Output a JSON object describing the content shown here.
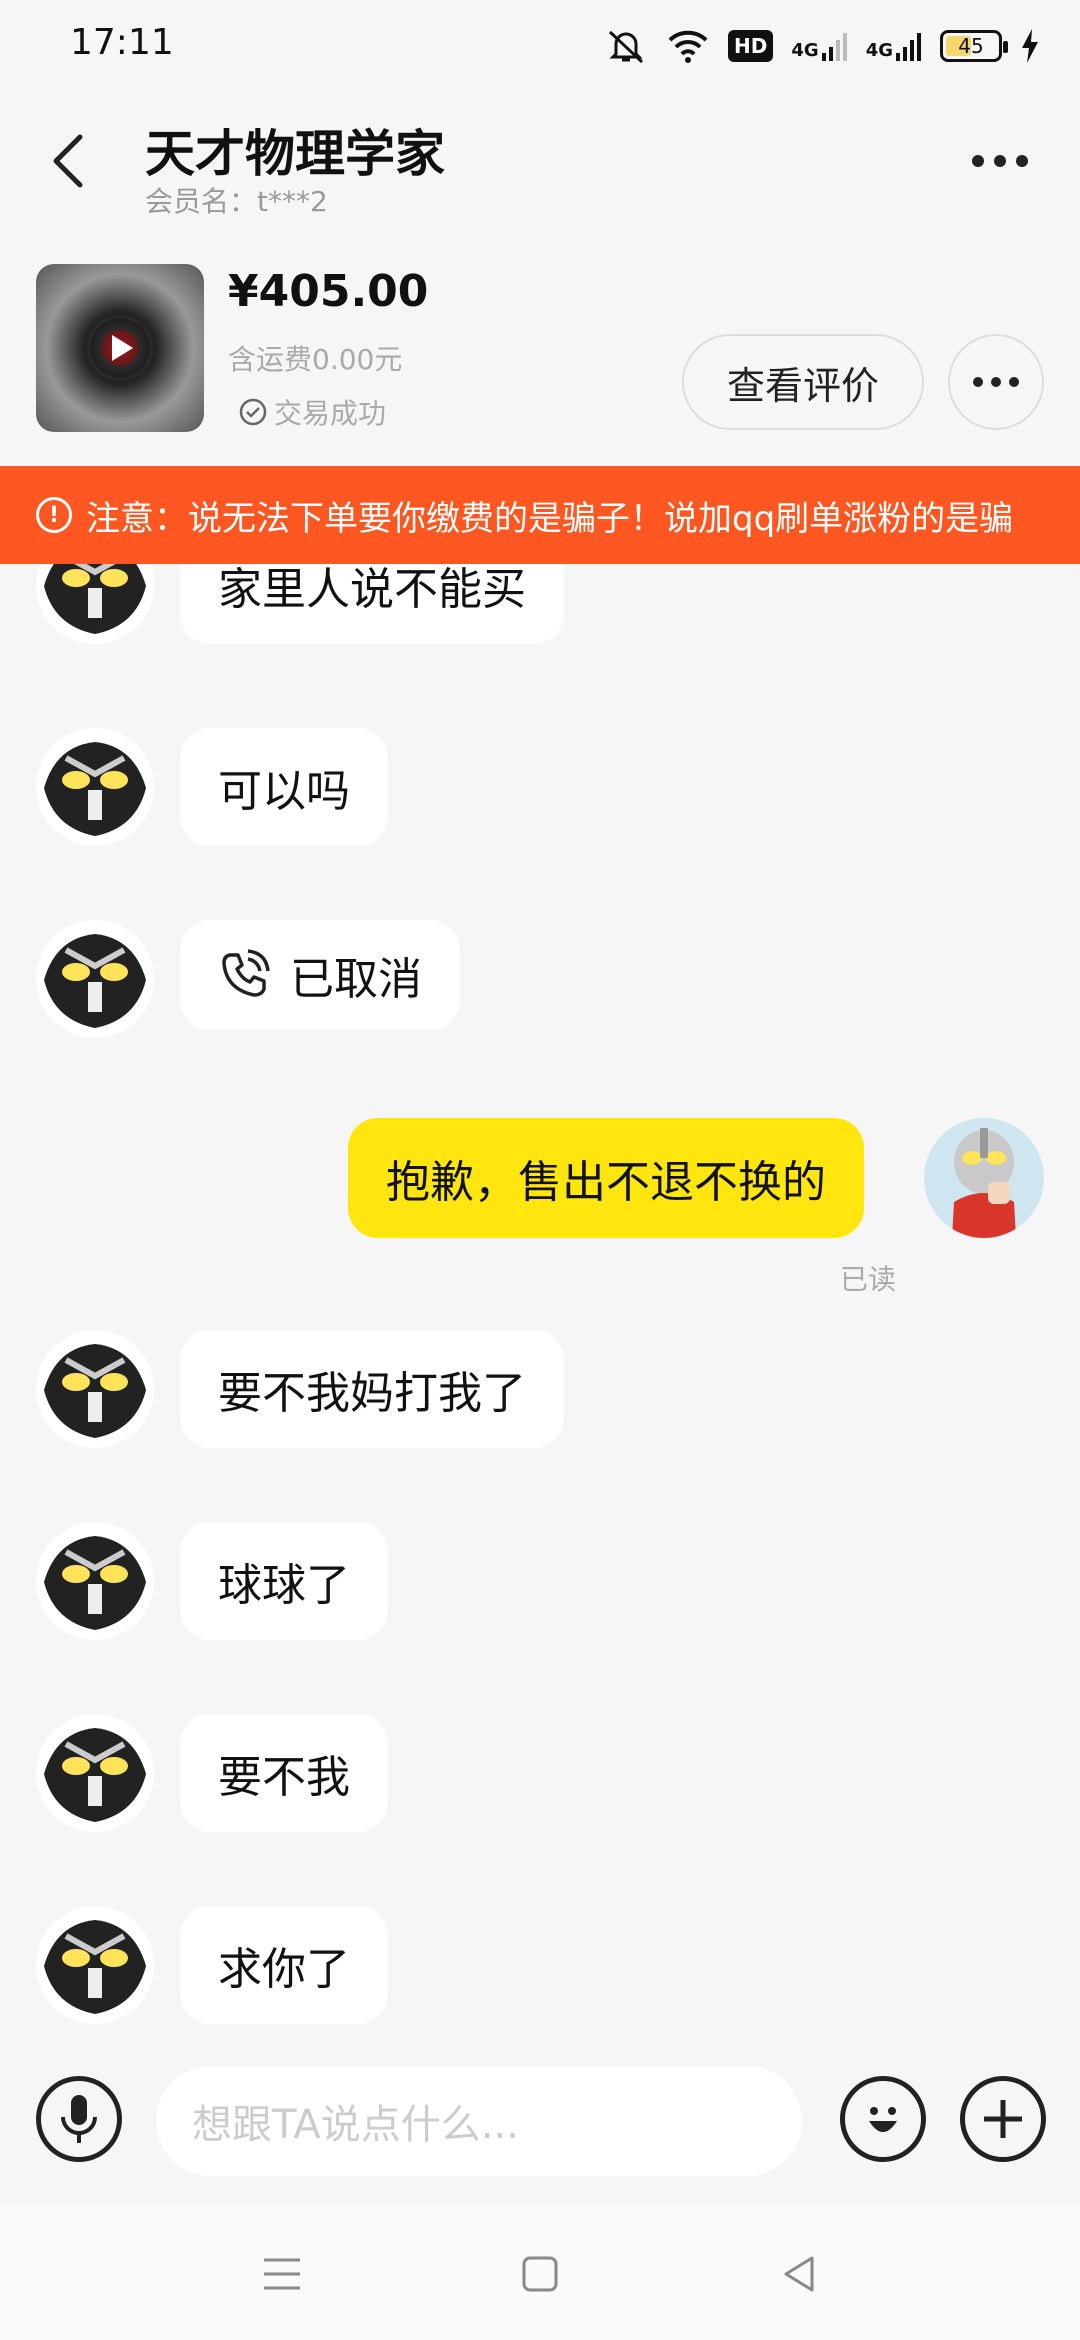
{
  "status_bar": {
    "time": "17:11",
    "icons": [
      "mute-bell-icon",
      "wifi-icon",
      "hd-voice-icon",
      "signal-4g-icon",
      "signal-4g-icon",
      "battery-icon",
      "charging-icon"
    ],
    "hd_label": "HD",
    "network_1": "4G",
    "network_2": "4G",
    "battery_level": "45"
  },
  "header": {
    "title": "天才物理学家",
    "subtitle": "会员名：t***2"
  },
  "product": {
    "price": "¥405.00",
    "shipping": "含运费0.00元",
    "deal_status": "交易成功",
    "review_button": "查看评价"
  },
  "warning": {
    "text": "注意：说无法下单要你缴费的是骗子！说加qq刷单涨粉的是骗"
  },
  "messages": [
    {
      "side": "left",
      "text": "家里人说不能买"
    },
    {
      "side": "left",
      "text": "可以吗"
    },
    {
      "side": "left",
      "type": "call",
      "text": "已取消"
    },
    {
      "side": "right",
      "text": "抱歉，售出不退不换的",
      "read_label": "已读"
    },
    {
      "side": "left",
      "text": "要不我妈打我了"
    },
    {
      "side": "left",
      "text": "球球了"
    },
    {
      "side": "left",
      "text": "要不我"
    },
    {
      "side": "left",
      "text": "求你了"
    }
  ],
  "input": {
    "placeholder": "想跟TA说点什么..."
  },
  "colors": {
    "warning_bg": "#ff5722",
    "my_bubble": "#ffe60f",
    "other_bubble": "#ffffff",
    "page_bg": "#f6f6f6"
  }
}
